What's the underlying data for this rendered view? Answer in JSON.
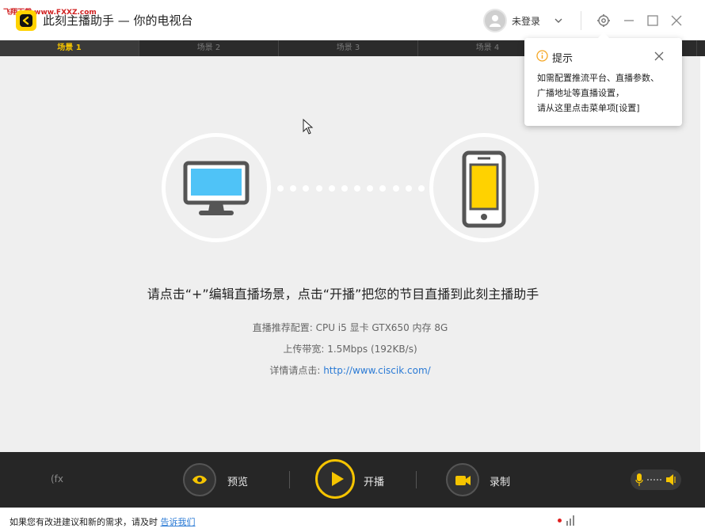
{
  "watermark": "飞翔下载 www.FXXZ.com",
  "app": {
    "title": "此刻主播助手 — 你的电视台",
    "login_text": "未登录",
    "brand_color": "#ffd200"
  },
  "icons": {
    "logo": "ciscik-logo-icon",
    "avatar": "user-avatar-icon",
    "settings": "gear-icon",
    "minimize": "minimize-icon",
    "maximize": "maximize-icon",
    "close": "close-icon"
  },
  "tabs": [
    {
      "label": "场景 1",
      "active": true
    },
    {
      "label": "场景 2",
      "active": false
    },
    {
      "label": "场景 3",
      "active": false
    },
    {
      "label": "场景 4",
      "active": false
    },
    {
      "label": "",
      "active": false
    }
  ],
  "tooltip": {
    "title": "提示",
    "lines": [
      "如需配置推流平台、直播参数、",
      "广播地址等直播设置，",
      "请从这里点击菜单项[设置]"
    ]
  },
  "main": {
    "headline": "请点击“+”编辑直播场景，点击“开播”把您的节目直播到此刻主播助手",
    "spec_label": "直播推荐配置:",
    "spec_value": "CPU i5  显卡 GTX650  内存 8G",
    "upload_label": "上传带宽:",
    "upload_value": "1.5Mbps (192KB/s)",
    "detail_label": "详情请点击:",
    "detail_link": "http://www.ciscik.com/"
  },
  "toolbar": {
    "fx_label": "(fx",
    "preview_label": "预览",
    "live_label": "开播",
    "record_label": "录制",
    "accent_color": "#f5c400"
  },
  "status": {
    "text": "如果您有改进建议和新的需求，请及时",
    "link": "告诉我们"
  }
}
